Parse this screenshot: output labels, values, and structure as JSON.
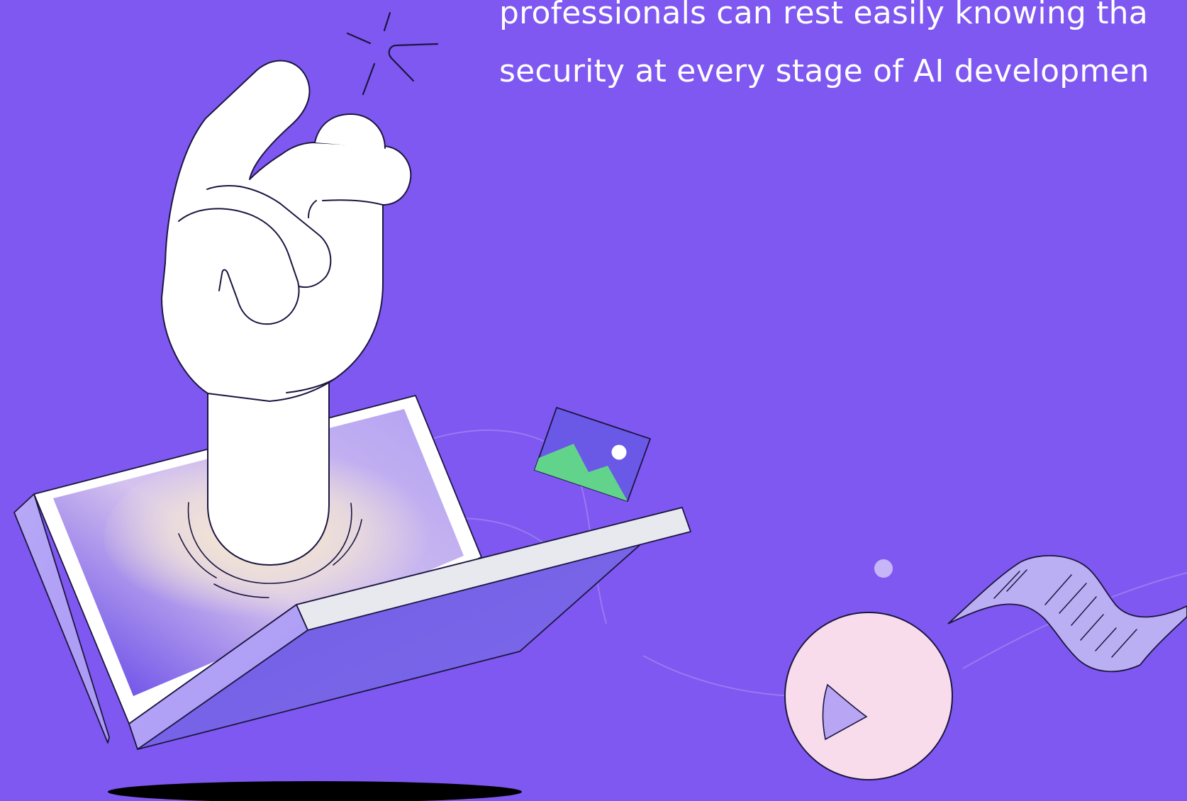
{
  "hero": {
    "lines": [
      "professionals can rest easily knowing tha",
      "security at every stage of AI developmen"
    ]
  },
  "colors": {
    "background": "#7F58F1",
    "white": "#FFFFFF",
    "outline": "#1B1640",
    "laptop_side": "#B5A4F5",
    "laptop_face": "#7764E4",
    "image_card": "#6A58E7",
    "mountain": "#61D38A",
    "play_circle": "#F8DCEB",
    "play_icon": "#B8A6F5",
    "paper_strip": "#BBAFF4",
    "shadow": "#000000"
  },
  "icons": [
    "hand-icon",
    "laptop-icon",
    "image-icon",
    "play-icon",
    "document-icon",
    "sparkle-icon"
  ]
}
